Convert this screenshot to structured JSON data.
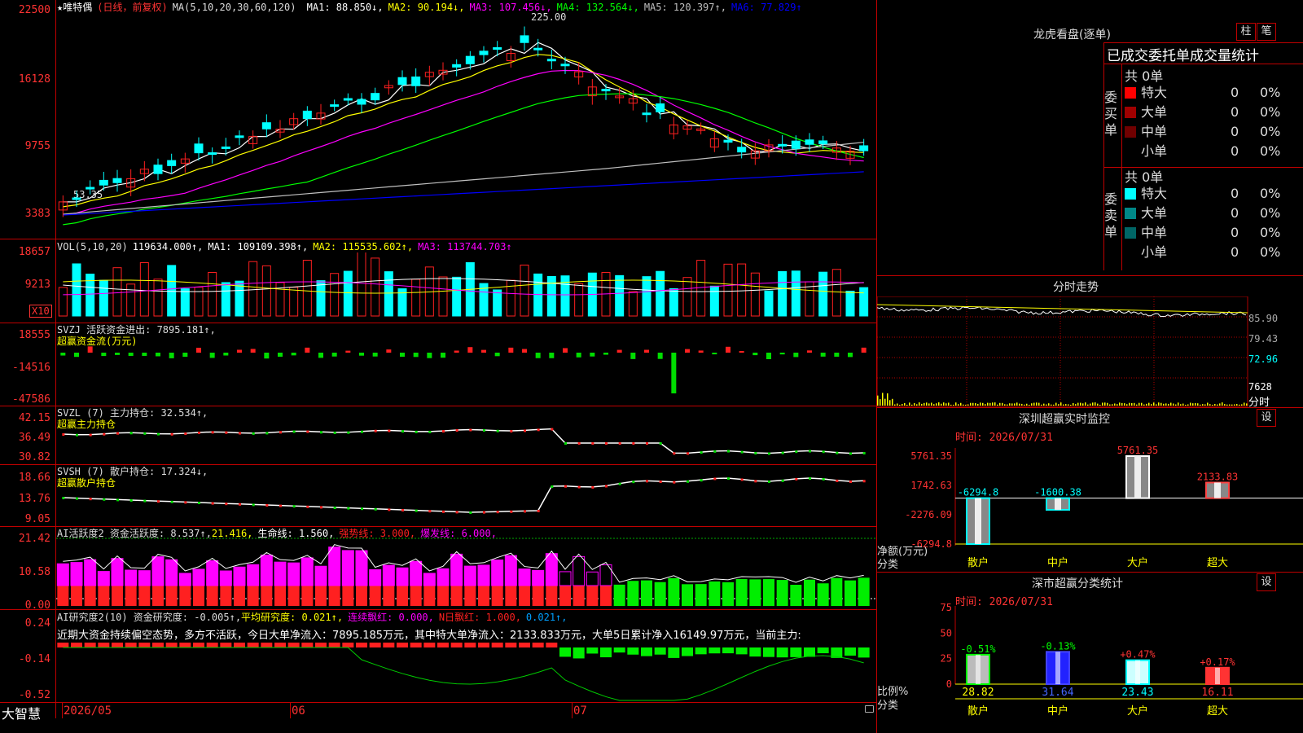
{
  "stock_name": "唯特偶",
  "chart_mode": "(日线，前复权)",
  "logo": "大智慧",
  "star": "★",
  "colors": {
    "up": "#ff2020",
    "down": "#00ffff",
    "grid": "#b00000",
    "ma1": "#ffffff",
    "ma2": "#ffff00",
    "ma3": "#ff00ff",
    "ma4": "#00ff00",
    "ma5": "#c0c0c0",
    "ma6": "#0000ff",
    "vol_ma1": "#ffffff",
    "vol_ma2": "#ffff00",
    "vol_ma3": "#ff00ff"
  },
  "price_panel": {
    "ma_params": "MA(5,10,20,30,60,120)",
    "ma_values": [
      {
        "label": "MA1: 88.850↓,",
        "color": "#ffffff"
      },
      {
        "label": "MA2: 90.194↓,",
        "color": "#ffff00"
      },
      {
        "label": "MA3: 107.456↓,",
        "color": "#ff00ff"
      },
      {
        "label": "MA4: 132.564↓,",
        "color": "#00ff00"
      },
      {
        "label": "MA5: 120.397↑,",
        "color": "#c0c0c0"
      },
      {
        "label": "MA6: 77.829↑",
        "color": "#0000ff"
      }
    ],
    "y_ticks": [
      "22500",
      "16128",
      "9755",
      "3383"
    ],
    "high_label": "225.00",
    "low_label": "53.35"
  },
  "vol_panel": {
    "title": "VOL(5,10,20)",
    "value": "119634.000↑,",
    "ma": [
      {
        "label": "MA1: 109109.398↑,",
        "color": "#ffffff"
      },
      {
        "label": "MA2: 115535.602↑,",
        "color": "#ffff00"
      },
      {
        "label": "MA3: 113744.703↑",
        "color": "#ff00ff"
      }
    ],
    "y_ticks": [
      "18657",
      "9213"
    ],
    "unit": "X10"
  },
  "svzj_panel": {
    "title": "SVZJ  活跃资金进出: 7895.181↑,",
    "subtitle": "超赢资金流(万元)",
    "y_ticks": [
      "18555",
      "-14516",
      "-47586"
    ]
  },
  "svzl_panel": {
    "title": "SVZL (7) 主力持仓: 32.534↑,",
    "subtitle": "超赢主力持仓",
    "y_ticks": [
      "42.15",
      "36.49",
      "30.82"
    ]
  },
  "svsh_panel": {
    "title": "SVSH (7) 散户持仓: 17.324↓,",
    "subtitle": "超赢散户持仓",
    "y_ticks": [
      "18.66",
      "13.76",
      "9.05"
    ]
  },
  "ai2_panel": {
    "title": "AI活跃度2 资金活跃度: 8.537↑,",
    "v2": "21.416,",
    "v3": "生命线: 1.560,",
    "v4": "强势线: 3.000,",
    "v5": "爆发线: 6.000,",
    "y_ticks": [
      "21.42",
      "10.58",
      "0.00"
    ]
  },
  "ai_study_panel": {
    "title": "AI研究度2(10) 资金研究度: -0.005↑,",
    "v2": "平均研究度: 0.021↑,",
    "v3": "连续飘红: 0.000,",
    "v4": "N日飘红: 1.000,",
    "v5": "0.021↑,",
    "comment": "近期大资金持续偏空态势，多方不活跃，今日大单净流入：7895.185万元，其中特大单净流入：2133.833万元，大单5日累计净入16149.97万元，当前主力:",
    "y_ticks": [
      "0.24",
      "-0.14",
      "-0.52"
    ]
  },
  "date_axis": [
    "2026/05",
    "06",
    "07"
  ],
  "lhb": {
    "title": "龙虎看盘(逐单)",
    "btn1": "柱",
    "btn2": "笔",
    "tab_title": "已成交委托单成交量统计",
    "buy_label": "委买单",
    "sell_label": "委卖单",
    "buy_total": "共 0单",
    "sell_total": "共 0单",
    "buy_rows": [
      {
        "name": "特大",
        "count": "0",
        "pct": "0%",
        "color": "#ff0000"
      },
      {
        "name": "大单",
        "count": "0",
        "pct": "0%",
        "color": "#a00000"
      },
      {
        "name": "中单",
        "count": "0",
        "pct": "0%",
        "color": "#700000"
      },
      {
        "name": "小单",
        "count": "0",
        "pct": "0%",
        "color": "#000000"
      }
    ],
    "sell_rows": [
      {
        "name": "特大",
        "count": "0",
        "pct": "0%",
        "color": "#00ffff"
      },
      {
        "name": "大单",
        "count": "0",
        "pct": "0%",
        "color": "#008888"
      },
      {
        "name": "中单",
        "count": "0",
        "pct": "0%",
        "color": "#006666"
      },
      {
        "name": "小单",
        "count": "0",
        "pct": "0%",
        "color": "#000000"
      }
    ]
  },
  "intraday": {
    "title": "分时走势",
    "y_ticks": [
      "85.90",
      "79.43",
      "72.96"
    ],
    "vol_label": "7628",
    "unit_label": "分时"
  },
  "monitor": {
    "title": "深圳超赢实时监控",
    "btn": "设",
    "time": "时间: 2026/07/31",
    "y_ticks": [
      "5761.35",
      "1742.63",
      "-2276.09",
      "-6294.8"
    ],
    "ylabel1": "净额(万元)",
    "ylabel2": "分类",
    "categories": [
      "散户",
      "中户",
      "大户",
      "超大"
    ],
    "value_labels": [
      "-6294.8",
      "-1600.38",
      "5761.35",
      "2133.83"
    ]
  },
  "classify": {
    "title": "深市超赢分类统计",
    "btn": "设",
    "time": "时间: 2026/07/31",
    "y_ticks": [
      "75",
      "50",
      "25",
      "0"
    ],
    "ylabel1": "比例%",
    "ylabel2": "分类",
    "categories": [
      "散户",
      "中户",
      "大户",
      "超大"
    ],
    "pct_labels": [
      "-0.51%",
      "-0.13%",
      "+0.47%",
      "+0.17%"
    ],
    "value_labels": [
      "28.82",
      "31.64",
      "23.43",
      "16.11"
    ]
  },
  "chart_data": [
    {
      "type": "bar",
      "title": "深圳超赢实时监控",
      "ylabel": "净额(万元)",
      "categories": [
        "散户",
        "中户",
        "大户",
        "超大"
      ],
      "values": [
        -6294.8,
        -1600.38,
        5761.35,
        2133.83
      ],
      "ylim": [
        -6294.8,
        5761.35
      ]
    },
    {
      "type": "bar",
      "title": "深市超赢分类统计",
      "ylabel": "比例%",
      "categories": [
        "散户",
        "中户",
        "大户",
        "超大"
      ],
      "values": [
        28.82,
        31.64,
        23.43,
        16.11
      ],
      "ylim": [
        0,
        75
      ]
    }
  ]
}
